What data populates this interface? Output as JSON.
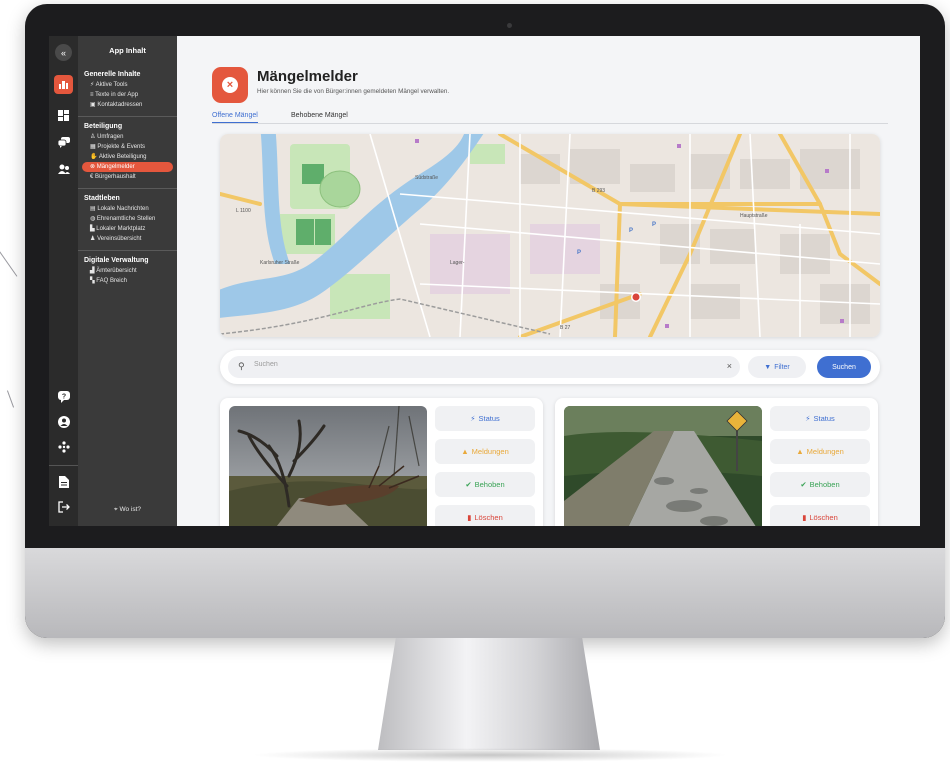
{
  "sidebar": {
    "title": "App Inhalt",
    "sections": [
      {
        "heading": "Generelle Inhalte",
        "items": [
          "Aktive Tools",
          "Texte in der App",
          "Kontaktadressen"
        ]
      },
      {
        "heading": "Beteiligung",
        "items": [
          "Umfragen",
          "Projekte & Events",
          "Aktive Beteiligung",
          "Mängelmelder",
          "Bürgerhaushalt"
        ]
      },
      {
        "heading": "Stadtleben",
        "items": [
          "Lokale Nachrichten",
          "Ehrenamtliche Stellen",
          "Lokaler Marktplatz",
          "Vereinsübersicht"
        ]
      },
      {
        "heading": "Digitale Verwaltung",
        "items": [
          "Ämterübersicht",
          "FAQ Breich"
        ]
      }
    ],
    "footer": "Wo ist?"
  },
  "page": {
    "title": "Mängelmelder",
    "subtitle": "Hier können Sie die von Bürger:innen gemeldeten Mängel verwalten."
  },
  "tabs": [
    "Offene Mängel",
    "Behobene Mängel"
  ],
  "search": {
    "placeholder": "Suchen",
    "filter_label": "Filter",
    "button_label": "Suchen"
  },
  "card_actions": {
    "status": "Status",
    "meldungen": "Meldungen",
    "behoben": "Behoben",
    "loeschen": "Löschen"
  },
  "map": {
    "labels": [
      "L 1100",
      "B 293",
      "Südstraße",
      "Lager-",
      "Hauptstraße",
      "B 27",
      "Karlsruher Straße"
    ]
  },
  "colors": {
    "accent": "#e4573d",
    "primary": "#3f6fd1",
    "sidebar": "#3a3a3a",
    "iconbar": "#2b2b2b"
  }
}
